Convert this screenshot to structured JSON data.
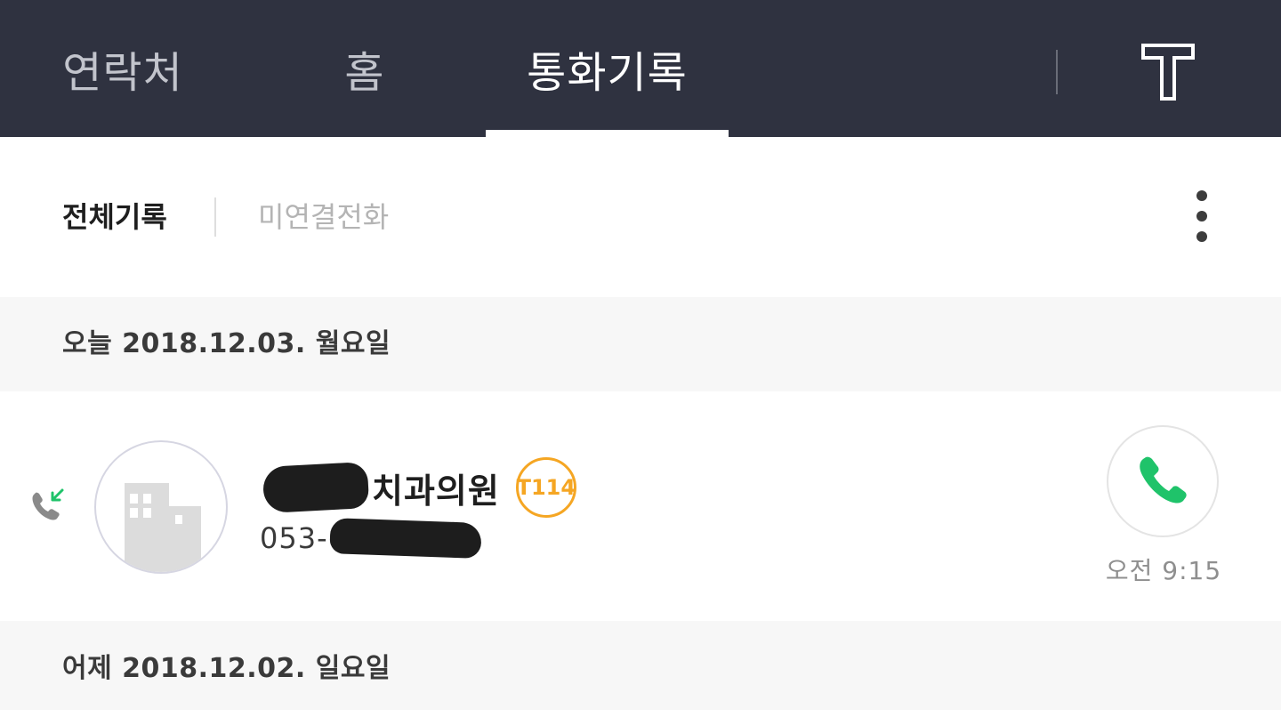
{
  "tabs": {
    "contacts": "연락처",
    "home": "홈",
    "call_log": "통화기록",
    "logo": "T"
  },
  "filters": {
    "all": "전체기록",
    "missed": "미연결전화"
  },
  "sections": {
    "today": "오늘 2018.12.03. 월요일",
    "yesterday": "어제 2018.12.02. 일요일"
  },
  "call_log": [
    {
      "name_visible": "치과의원",
      "badge": "T114",
      "number_visible": "053-",
      "time": "오전 9:15",
      "call_type_icon": "incoming-call-icon"
    }
  ],
  "colors": {
    "topbar_bg": "#2f3240",
    "accent_green": "#1fc36a",
    "badge_orange": "#f5a623",
    "section_bg": "#f7f7f7"
  },
  "icons": {
    "more": "more-vertical-icon",
    "call": "phone-icon",
    "avatar": "building-icon"
  }
}
